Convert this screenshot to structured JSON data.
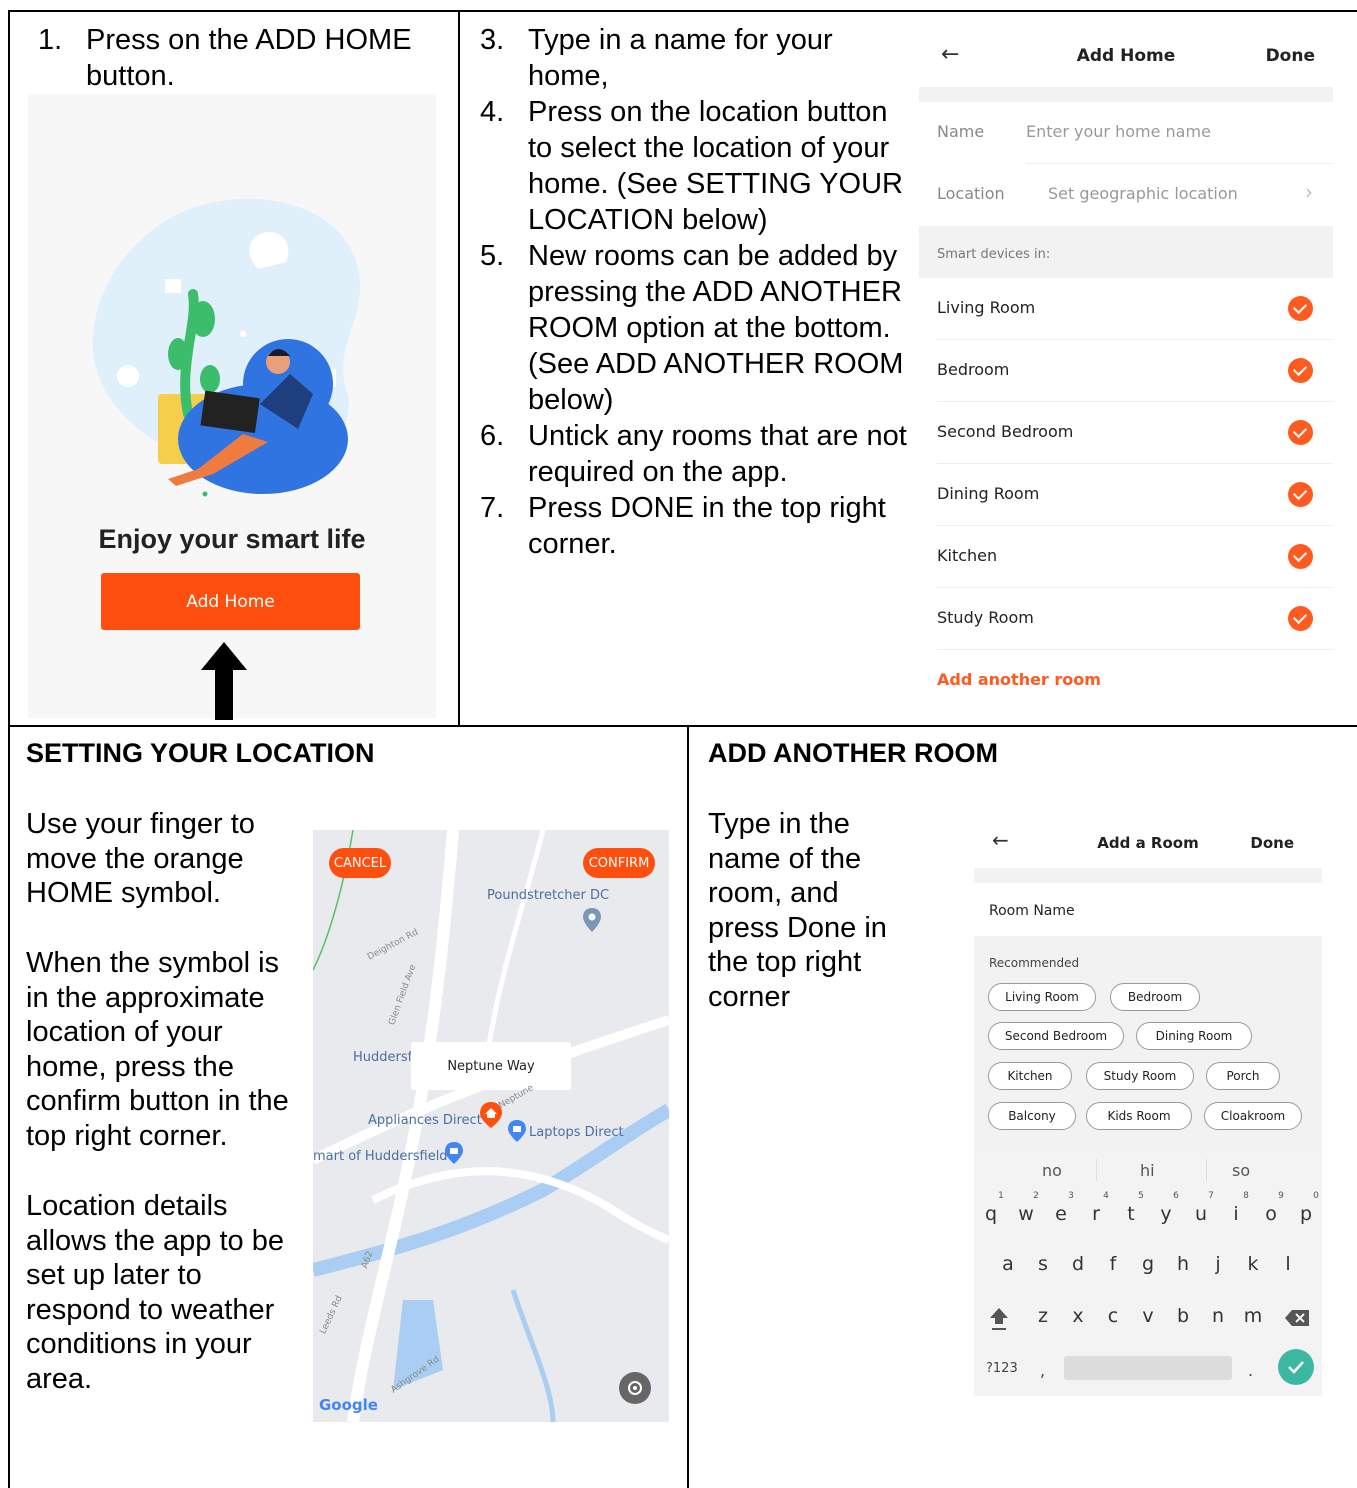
{
  "top_left": {
    "step_number": "1.",
    "step_text": "Press on the ADD HOME button."
  },
  "phone_welcome": {
    "headline": "Enjoy your smart life",
    "button_label": "Add Home"
  },
  "top_middle": {
    "steps": [
      {
        "num": "3.",
        "text": "Type in a name for your home,"
      },
      {
        "num": "4.",
        "text": "Press on the location button to select the location of your home.  (See SETTING YOUR LOCATION below)"
      },
      {
        "num": "5.",
        "text": "New rooms can be added by pressing the ADD ANOTHER ROOM option at the bottom. (See ADD ANOTHER ROOM below)"
      },
      {
        "num": "6.",
        "text": "Untick any rooms that are not required on the app."
      },
      {
        "num": "7.",
        "text": "Press DONE in the top right corner."
      }
    ]
  },
  "phone_add_home": {
    "title": "Add Home",
    "done_label": "Done",
    "back_glyph": "←",
    "name_label": "Name",
    "name_placeholder": "Enter your home name",
    "location_label": "Location",
    "location_value": "Set geographic location",
    "chevron_glyph": "›",
    "section_label": "Smart devices in:",
    "rooms": [
      "Living Room",
      "Bedroom",
      "Second Bedroom",
      "Dining Room",
      "Kitchen",
      "Study Room"
    ],
    "add_room_label": "Add another room"
  },
  "setting_location": {
    "heading": "SETTING YOUR LOCATION",
    "para1": "Use your finger to move the orange HOME symbol.",
    "para2": "When the symbol is in the approximate location of your home, press the confirm button in the top right corner.",
    "para3": "Location details allows the app to be set up later to respond to weather conditions in your area."
  },
  "map": {
    "cancel_label": "CANCEL",
    "confirm_label": "CONFIRM",
    "popup_label": "Neptune Way",
    "places": [
      "Poundstretcher DC",
      "Huddersf",
      "Appliances Direct",
      "Laptops Direct",
      "mart of Huddersfield"
    ],
    "roads": [
      "Deighton Rd",
      "Glen Field Ave",
      "A62",
      "Leeds Rd",
      "Ashgrove Rd",
      "Neptune"
    ],
    "attribution": "Google",
    "colors": {
      "water": "#a9cdf3",
      "road": "#ffffff",
      "accent": "#ff4f0f"
    }
  },
  "add_another_room": {
    "heading": "ADD ANOTHER ROOM",
    "para": "Type in the name of the room, and press Done in the top right corner"
  },
  "phone_add_room": {
    "title": "Add a Room",
    "done_label": "Done",
    "back_glyph": "←",
    "room_name_label": "Room Name",
    "recommended_label": "Recommended",
    "chips": [
      "Living Room",
      "Bedroom",
      "Second Bedroom",
      "Dining Room",
      "Kitchen",
      "Study Room",
      "Porch",
      "Balcony",
      "Kids Room",
      "Cloakroom"
    ],
    "suggestions": [
      "no",
      "hi",
      "so"
    ],
    "keyboard": {
      "row1": [
        "q",
        "w",
        "e",
        "r",
        "t",
        "y",
        "u",
        "i",
        "o",
        "p"
      ],
      "row1_numbers": [
        "1",
        "2",
        "3",
        "4",
        "5",
        "6",
        "7",
        "8",
        "9",
        "0"
      ],
      "row2": [
        "a",
        "s",
        "d",
        "f",
        "g",
        "h",
        "j",
        "k",
        "l"
      ],
      "row3": [
        "z",
        "x",
        "c",
        "v",
        "b",
        "n",
        "m"
      ],
      "mode_key": "?123",
      "comma": ",",
      "period": "."
    }
  }
}
